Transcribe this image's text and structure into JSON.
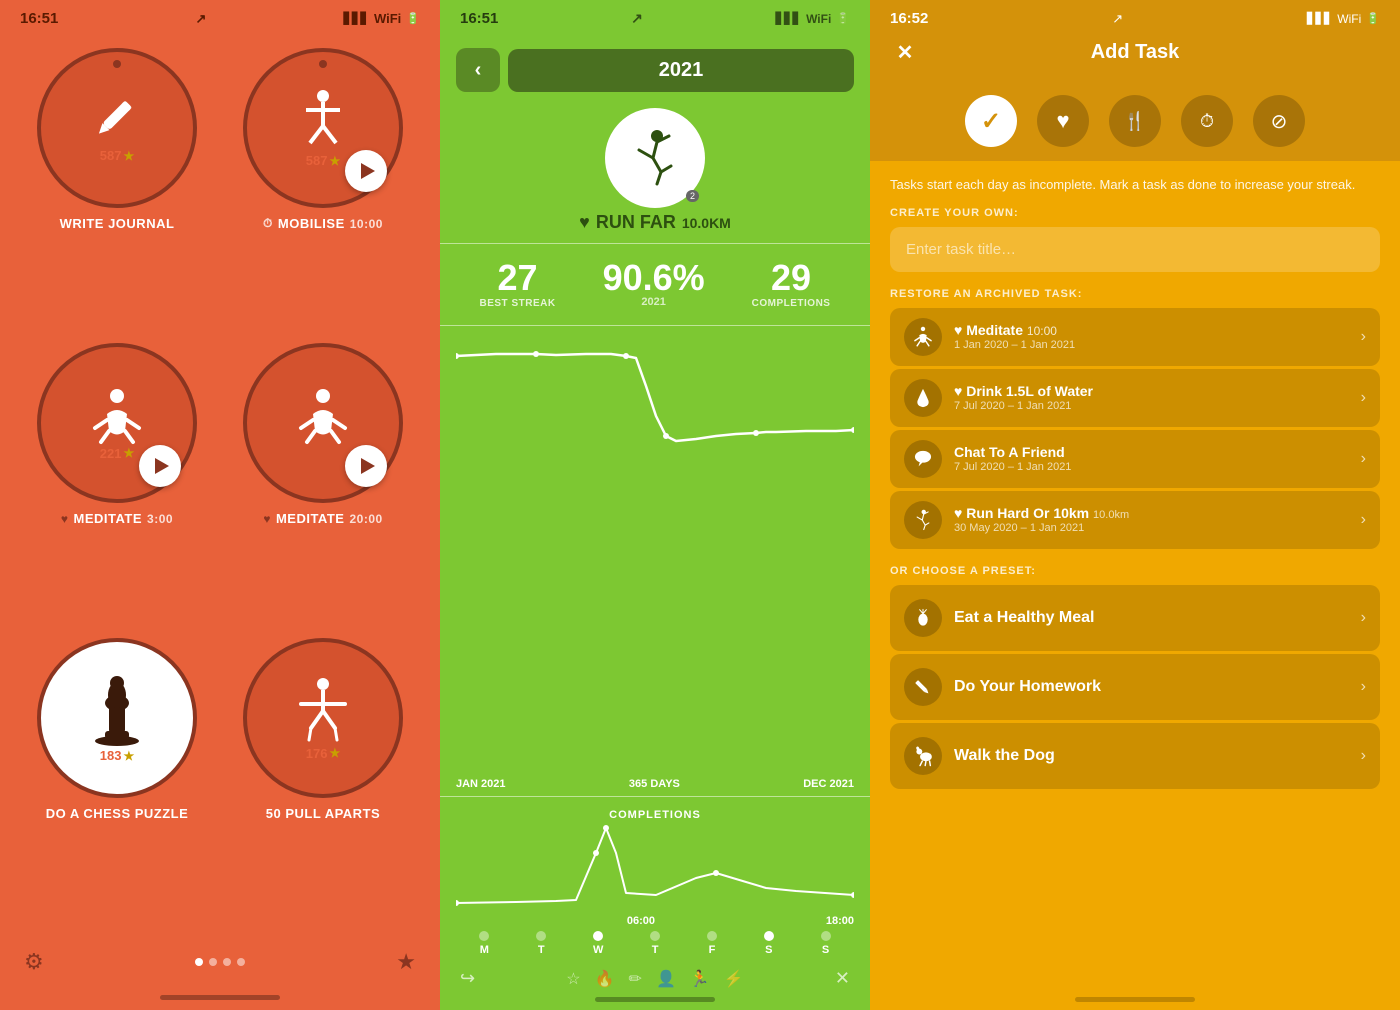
{
  "panel1": {
    "status_time": "16:51",
    "status_arrow": "↗",
    "activities": [
      {
        "id": "write-journal",
        "icon": "✏️",
        "icon_type": "pen",
        "count": "587",
        "label": "WRITE JOURNAL",
        "has_play": false,
        "dot_top": true,
        "heart_label": false
      },
      {
        "id": "mobilise",
        "icon": "🏋️",
        "icon_type": "mobilise",
        "count": "587",
        "label": "MOBILISE",
        "time_label": "10:00",
        "has_play": true,
        "dot_top": true,
        "heart_label": false,
        "has_clock": true
      },
      {
        "id": "meditate1",
        "icon": "🧘",
        "icon_type": "meditate",
        "count": "221",
        "label": "MEDITATE",
        "time_label": "3:00",
        "has_play": true,
        "dot_top": false,
        "heart_label": true
      },
      {
        "id": "meditate2",
        "icon": "🧘",
        "icon_type": "meditate",
        "count": "",
        "label": "MEDITATE",
        "time_label": "20:00",
        "has_play": true,
        "dot_top": false,
        "heart_label": true
      },
      {
        "id": "chess",
        "icon": "♟️",
        "icon_type": "chess",
        "count": "183",
        "label": "DO A CHESS PUZZLE",
        "has_play": false,
        "dot_top": false,
        "heart_label": false,
        "white_bg": true
      },
      {
        "id": "pull-aparts",
        "icon": "🤸",
        "icon_type": "pull",
        "count": "176",
        "label": "50 PULL APARTS",
        "has_play": false,
        "dot_top": false,
        "heart_label": false
      }
    ],
    "bottom": {
      "gear_label": "⚙",
      "star_label": "★"
    }
  },
  "panel2": {
    "status_time": "16:51",
    "year": "2021",
    "activity_name": "RUN FAR",
    "activity_km": "10.0KM",
    "best_streak": "27",
    "best_streak_label": "BEST STREAK",
    "completion_pct": "90.6%",
    "completion_year": "2021",
    "completions": "29",
    "completions_label": "COMPLETIONS",
    "chart_label_left": "JAN 2021",
    "chart_label_mid": "365 DAYS",
    "chart_label_right": "DEC 2021",
    "completions_section": "COMPLETIONS",
    "time_label_left": "06:00",
    "time_label_right": "18:00",
    "weekdays": [
      "M",
      "T",
      "W",
      "T",
      "F",
      "S",
      "S"
    ],
    "weekday_filled": [
      false,
      false,
      true,
      false,
      false,
      true,
      false
    ]
  },
  "panel3": {
    "status_time": "16:52",
    "header_title": "Add Task",
    "close_label": "✕",
    "description": "Tasks start each day as incomplete. Mark a task as done to increase your streak.",
    "create_heading": "CREATE YOUR OWN:",
    "input_placeholder": "Enter task title…",
    "restore_heading": "RESTORE AN ARCHIVED TASK:",
    "preset_heading": "OR CHOOSE A PRESET:",
    "type_icons": [
      "✓",
      "♥",
      "🍴",
      "⏱",
      "⊘"
    ],
    "archived_tasks": [
      {
        "icon": "🧘",
        "icon_type": "meditate",
        "name": "Meditate",
        "heart": true,
        "time": "10:00",
        "date": "1 Jan 2020 – 1 Jan 2021"
      },
      {
        "icon": "💧",
        "icon_type": "water",
        "name": "Drink 1.5L of Water",
        "heart": true,
        "date": "7 Jul 2020 – 1 Jan 2021"
      },
      {
        "icon": "💬",
        "icon_type": "chat",
        "name": "Chat To A Friend",
        "heart": false,
        "date": "7 Jul 2020 – 1 Jan 2021"
      },
      {
        "icon": "🏃",
        "icon_type": "run",
        "name": "Run Hard Or 10km",
        "heart": true,
        "km": "10.0km",
        "date": "30 May 2020 – 1 Jan 2021"
      }
    ],
    "preset_tasks": [
      {
        "icon": "🍎",
        "icon_type": "food",
        "name": "Eat a Healthy Meal"
      },
      {
        "icon": "✏️",
        "icon_type": "pencil",
        "name": "Do Your Homework"
      },
      {
        "icon": "🐕",
        "icon_type": "dog",
        "name": "Walk the Dog"
      }
    ]
  }
}
